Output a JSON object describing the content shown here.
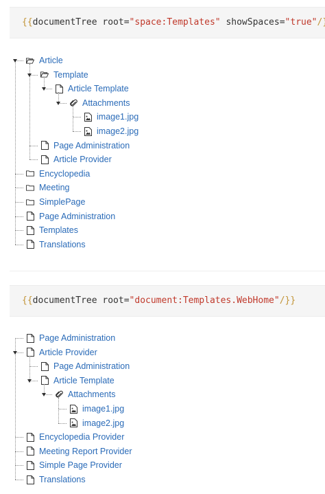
{
  "snippets": [
    {
      "open": "{{",
      "macro": "documentTree",
      "params": [
        {
          "name": "root",
          "value": "\"space:Templates\""
        },
        {
          "name": "showSpaces",
          "value": "\"true\""
        }
      ],
      "close": "/}}"
    },
    {
      "open": "{{",
      "macro": "documentTree",
      "params": [
        {
          "name": "root",
          "value": "\"document:Templates.WebHome\""
        }
      ],
      "close": "/}}"
    }
  ],
  "trees": [
    {
      "nodes": [
        {
          "label": "Article",
          "icon": "folder-open-icon",
          "level": 0,
          "expanded": true
        },
        {
          "label": "Template",
          "icon": "folder-open-icon",
          "level": 1,
          "expanded": true
        },
        {
          "label": "Article Template",
          "icon": "file-icon",
          "level": 2,
          "expanded": true
        },
        {
          "label": "Attachments",
          "icon": "paperclip-icon",
          "level": 3,
          "expanded": true
        },
        {
          "label": "image1.jpg",
          "icon": "image-icon",
          "level": 4
        },
        {
          "label": "image2.jpg",
          "icon": "image-icon",
          "level": 4
        },
        {
          "label": "Page Administration",
          "icon": "file-icon",
          "level": 1
        },
        {
          "label": "Article Provider",
          "icon": "file-icon",
          "level": 1
        },
        {
          "label": "Encyclopedia",
          "icon": "folder-icon",
          "level": 0
        },
        {
          "label": "Meeting",
          "icon": "folder-icon",
          "level": 0
        },
        {
          "label": "SimplePage",
          "icon": "folder-icon",
          "level": 0
        },
        {
          "label": "Page Administration",
          "icon": "file-icon",
          "level": 0
        },
        {
          "label": "Templates",
          "icon": "file-icon",
          "level": 0
        },
        {
          "label": "Translations",
          "icon": "file-icon",
          "level": 0
        }
      ]
    },
    {
      "nodes": [
        {
          "label": "Page Administration",
          "icon": "file-icon",
          "level": 0
        },
        {
          "label": "Article Provider",
          "icon": "file-icon",
          "level": 0,
          "expanded": true
        },
        {
          "label": "Page Administration",
          "icon": "file-icon",
          "level": 1
        },
        {
          "label": "Article Template",
          "icon": "file-icon",
          "level": 1,
          "expanded": true
        },
        {
          "label": "Attachments",
          "icon": "paperclip-icon",
          "level": 2,
          "expanded": true
        },
        {
          "label": "image1.jpg",
          "icon": "image-icon",
          "level": 3
        },
        {
          "label": "image2.jpg",
          "icon": "image-icon",
          "level": 3
        },
        {
          "label": "Encyclopedia Provider",
          "icon": "file-icon",
          "level": 0
        },
        {
          "label": "Meeting Report Provider",
          "icon": "file-icon",
          "level": 0
        },
        {
          "label": "Simple Page Provider",
          "icon": "file-icon",
          "level": 0
        },
        {
          "label": "Translations",
          "icon": "file-icon",
          "level": 0
        }
      ]
    }
  ],
  "colors": {
    "link": "#2a6bb8",
    "code_bg": "#f5f5f5",
    "code_brace": "#c29436",
    "code_string": "#c0392b",
    "tree_line": "#8a8a8a"
  }
}
